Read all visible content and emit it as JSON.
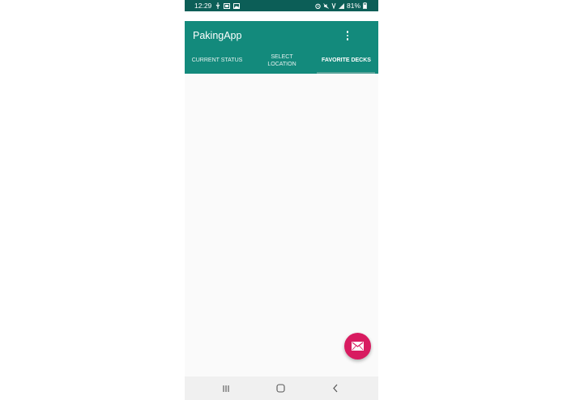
{
  "status_bar": {
    "time": "12:29",
    "battery": "81%",
    "left_icons": [
      "usb-icon",
      "screenshot-icon",
      "image-icon"
    ],
    "right_icons": [
      "alarm-icon",
      "mute-icon",
      "wifi-icon",
      "signal-icon",
      "battery-icon"
    ]
  },
  "app_bar": {
    "title": "PakingApp",
    "menu_icon": "more-vert-icon"
  },
  "tabs": [
    {
      "label_line1": "CURRENT STATUS",
      "label_line2": "",
      "active": false
    },
    {
      "label_line1": "SELECT",
      "label_line2": "LOCATION",
      "active": false
    },
    {
      "label_line1": "FAVORITE DECKS",
      "label_line2": "",
      "active": true
    }
  ],
  "fab": {
    "icon": "email-icon",
    "color": "#d81b60"
  },
  "nav_bar": {
    "buttons": [
      "recents-icon",
      "home-icon",
      "back-icon"
    ]
  },
  "colors": {
    "primary": "#138a7c",
    "primary_dark": "#0c5e57",
    "accent": "#d81b60",
    "background": "#fafafa"
  }
}
